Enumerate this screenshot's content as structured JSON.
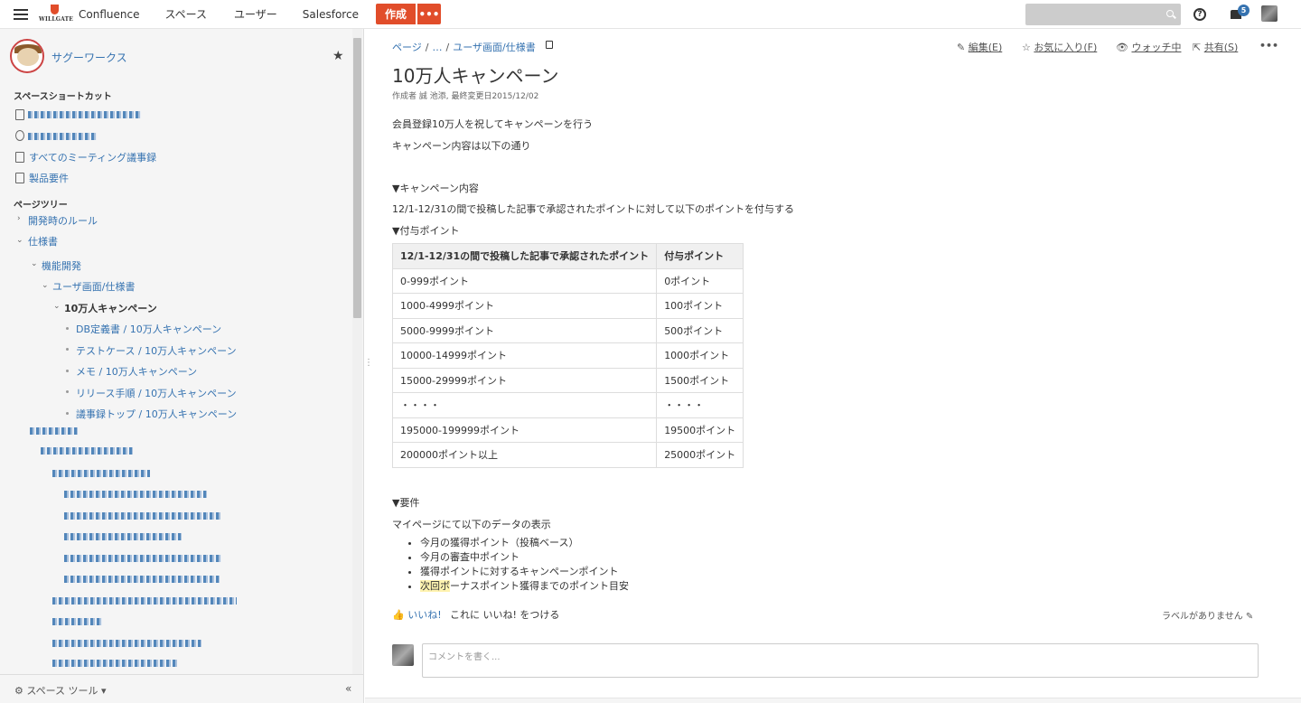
{
  "topnav": {
    "logo_text": "WILLGATE",
    "items": [
      "Confluence",
      "スペース",
      "ユーザー",
      "Salesforce"
    ],
    "create_label": "作成",
    "more_label": "•••",
    "help_label": "?",
    "notification_count": "5"
  },
  "sidebar": {
    "space_name": "サグーワークス",
    "shortcuts_heading": "スペースショートカット",
    "shortcut_all_meetings": "すべてのミーティング議事録",
    "shortcut_product_reqs": "製品要件",
    "page_tree_heading": "ページツリー",
    "tree": {
      "dev_rules": "開発時のルール",
      "spec": "仕様書",
      "feature_dev": "機能開発",
      "user_screen": "ユーザ画面/仕様書",
      "current_page": "10万人キャンペーン",
      "children": [
        "DB定義書 / 10万人キャンペーン",
        "テストケース / 10万人キャンペーン",
        "メモ / 10万人キャンペーン",
        "リリース手順 / 10万人キャンペーン",
        "議事録トップ / 10万人キャンペーン"
      ]
    },
    "space_tools_label": "スペース ツール",
    "collapse_label": "«"
  },
  "main": {
    "breadcrumb": [
      "ページ",
      "…",
      "ユーザ画面/仕様書"
    ],
    "actions": {
      "edit": "編集(E)",
      "favorite": "お気に入り(F)",
      "watching": "ウォッチ中",
      "share": "共有(S)",
      "more": "•••"
    },
    "title": "10万人キャンペーン",
    "byline": "作成者 誠 池添, 最終変更日2015/12/02",
    "intro1": "会員登録10万人を祝してキャンペーンを行う",
    "intro2": "キャンペーン内容は以下の通り",
    "section_campaign": "▼キャンペーン内容",
    "campaign_desc": "12/1-12/31の間で投稿した記事で承認されたポイントに対して以下のポイントを付与する",
    "section_points": "▼付与ポイント",
    "table": {
      "headers": [
        "12/1-12/31の間で投稿した記事で承認されたポイント",
        "付与ポイント"
      ],
      "rows": [
        [
          "0-999ポイント",
          "0ポイント"
        ],
        [
          "1000-4999ポイント",
          "100ポイント"
        ],
        [
          "5000-9999ポイント",
          "500ポイント"
        ],
        [
          "10000-14999ポイント",
          "1000ポイント"
        ],
        [
          "15000-29999ポイント",
          "1500ポイント"
        ],
        [
          "・・・・",
          "・・・・"
        ],
        [
          "195000-199999ポイント",
          "19500ポイント"
        ],
        [
          "200000ポイント以上",
          "25000ポイント"
        ]
      ]
    },
    "section_reqs": "▼要件",
    "reqs_desc": "マイページにて以下のデータの表示",
    "reqs": [
      "今月の獲得ポイント（投稿ベース）",
      "今月の審査中ポイント",
      "獲得ポイントに対するキャンペーンポイント"
    ],
    "req_last_highlight": "次回ボ",
    "req_last_rest": "ーナスポイント獲得までのポイント目安",
    "like_label": "いいね!",
    "like_message": "これに いいね! をつける",
    "labels_text": "ラベルがありません",
    "comment_placeholder": "コメントを書く..."
  }
}
